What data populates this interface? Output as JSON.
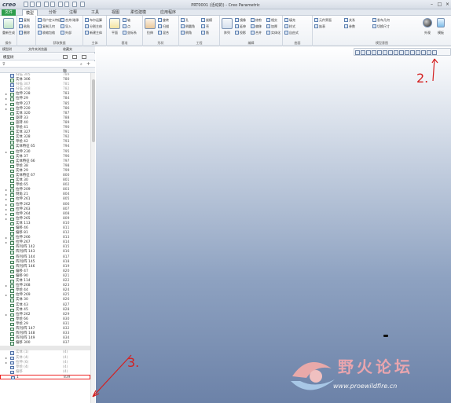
{
  "window": {
    "logo": "creo",
    "title": "PRT0001 (活动的) - Creo Parametric"
  },
  "menu": {
    "items": [
      "文件",
      "模型",
      "分析",
      "注释",
      "工具",
      "视图",
      "柔性建模",
      "应用程序"
    ],
    "active_index": 0,
    "selected_index": 1
  },
  "ribbon": {
    "groups": [
      {
        "label": "操作",
        "items": [
          "重新生成",
          "复制",
          "粘贴",
          "删除"
        ]
      },
      {
        "label": "获取数据",
        "items": [
          "用户定义特征",
          "复制几何",
          "收缩包络",
          "合并/继承",
          "导入",
          "外部"
        ]
      },
      {
        "label": "主体",
        "items": [
          "布尔运算",
          "分割主体",
          "新建主体"
        ]
      },
      {
        "label": "基准",
        "items": [
          "平面",
          "轴",
          "点",
          "坐标系",
          "草绘"
        ]
      },
      {
        "label": "形状",
        "items": [
          "拉伸",
          "旋转",
          "扫描",
          "混合",
          "扫描混合"
        ]
      },
      {
        "label": "工程",
        "items": [
          "孔",
          "倒圆角",
          "倒角",
          "拔模",
          "壳",
          "筋"
        ]
      },
      {
        "label": "编辑",
        "items": [
          "阵列",
          "镜像",
          "延伸",
          "投影",
          "修剪",
          "偏移",
          "合并",
          "相交",
          "加厚",
          "实体化",
          "移除"
        ]
      },
      {
        "label": "曲面",
        "items": [
          "填充",
          "样式",
          "自由式"
        ]
      },
      {
        "label": "模型意图",
        "items": [
          "元件界面",
          "族表",
          "关系",
          "参数",
          "发布几何",
          "切换尺寸",
          "外观",
          "模板"
        ]
      }
    ]
  },
  "sidebar": {
    "tabs": [
      "模型树",
      "文件夹浏览器",
      "收藏夹"
    ],
    "header": "模型树",
    "col_name": "",
    "col_num": "标",
    "rows": [
      {
        "name": "扫描 305",
        "num": "789",
        "type": "sup"
      },
      {
        "name": "实体 306",
        "num": "780",
        "type": "feat"
      },
      {
        "name": "扫描 307",
        "num": "781",
        "type": "sup"
      },
      {
        "name": "扫描 308",
        "num": "782",
        "type": "sup"
      },
      {
        "name": "拉伸 228",
        "num": "783",
        "type": "feat",
        "expand": true
      },
      {
        "name": "拉伸 29",
        "num": "784",
        "type": "feat",
        "expand": true
      },
      {
        "name": "拉伸 227",
        "num": "785",
        "type": "feat",
        "expand": true
      },
      {
        "name": "拉伸 220",
        "num": "786",
        "type": "feat",
        "expand": true
      },
      {
        "name": "实体 320",
        "num": "787",
        "type": "feat"
      },
      {
        "name": "旋转 33",
        "num": "788",
        "type": "feat"
      },
      {
        "name": "旋转 40",
        "num": "789",
        "type": "feat"
      },
      {
        "name": "草绘 41",
        "num": "790",
        "type": "feat"
      },
      {
        "name": "实体 327",
        "num": "791",
        "type": "feat"
      },
      {
        "name": "实体 328",
        "num": "792",
        "type": "feat"
      },
      {
        "name": "草绘 42",
        "num": "793",
        "type": "feat"
      },
      {
        "name": "实体特征 65",
        "num": "794",
        "type": "feat"
      },
      {
        "name": "拉伸 230",
        "num": "795",
        "type": "feat",
        "expand": true
      },
      {
        "name": "实体 37",
        "num": "796",
        "type": "feat"
      },
      {
        "name": "实体特征 66",
        "num": "797",
        "type": "feat"
      },
      {
        "name": "草绘 38",
        "num": "798",
        "type": "feat"
      },
      {
        "name": "实体 29",
        "num": "799",
        "type": "feat"
      },
      {
        "name": "实体特征 67",
        "num": "800",
        "type": "feat"
      },
      {
        "name": "实体 30",
        "num": "801",
        "type": "feat"
      },
      {
        "name": "草绘 65",
        "num": "802",
        "type": "feat"
      },
      {
        "name": "拉伸 209",
        "num": "803",
        "type": "feat",
        "expand": true
      },
      {
        "name": "倒角 21",
        "num": "804",
        "type": "feat",
        "expand": true
      },
      {
        "name": "拉伸 261",
        "num": "805",
        "type": "feat",
        "expand": true
      },
      {
        "name": "拉伸 262",
        "num": "806",
        "type": "feat",
        "expand": true
      },
      {
        "name": "拉伸 263",
        "num": "807",
        "type": "feat",
        "expand": true
      },
      {
        "name": "拉伸 264",
        "num": "808",
        "type": "feat",
        "expand": true
      },
      {
        "name": "拉伸 265",
        "num": "809",
        "type": "feat",
        "expand": true
      },
      {
        "name": "实体 113",
        "num": "810",
        "type": "feat"
      },
      {
        "name": "偏移 46",
        "num": "811",
        "type": "feat"
      },
      {
        "name": "偏移 81",
        "num": "812",
        "type": "feat"
      },
      {
        "name": "拉伸 266",
        "num": "813",
        "type": "feat",
        "expand": true
      },
      {
        "name": "拉伸 267",
        "num": "814",
        "type": "feat",
        "expand": true
      },
      {
        "name": "阵列/阵 142",
        "num": "815",
        "type": "feat"
      },
      {
        "name": "阵列/阵 143",
        "num": "816",
        "type": "feat"
      },
      {
        "name": "阵列/阵 144",
        "num": "817",
        "type": "feat"
      },
      {
        "name": "阵列/阵 145",
        "num": "818",
        "type": "feat"
      },
      {
        "name": "阵列/阵 146",
        "num": "819",
        "type": "feat"
      },
      {
        "name": "偏移 47",
        "num": "820",
        "type": "feat"
      },
      {
        "name": "偏移 90",
        "num": "821",
        "type": "feat"
      },
      {
        "name": "实体 114",
        "num": "822",
        "type": "feat"
      },
      {
        "name": "拉伸 268",
        "num": "823",
        "type": "feat",
        "expand": true
      },
      {
        "name": "草绘 44",
        "num": "824",
        "type": "feat"
      },
      {
        "name": "拉伸 269",
        "num": "825",
        "type": "feat",
        "expand": true
      },
      {
        "name": "实体 30",
        "num": "826",
        "type": "feat"
      },
      {
        "name": "实体 43",
        "num": "827",
        "type": "feat"
      },
      {
        "name": "实体 45",
        "num": "828",
        "type": "feat"
      },
      {
        "name": "拉伸 262",
        "num": "829",
        "type": "feat",
        "expand": true
      },
      {
        "name": "草绘 66",
        "num": "830",
        "type": "feat"
      },
      {
        "name": "草绘 29",
        "num": "831",
        "type": "feat"
      },
      {
        "name": "阵列/阵 147",
        "num": "832",
        "type": "feat"
      },
      {
        "name": "阵列/阵 148",
        "num": "833",
        "type": "feat"
      },
      {
        "name": "阵列/阵 149",
        "num": "834",
        "type": "feat"
      },
      {
        "name": "偏移 300",
        "num": "837",
        "type": "feat"
      },
      {
        "name": "",
        "num": "",
        "type": "dim"
      },
      {
        "name": "实体 (1)",
        "num": "(4)",
        "type": "sup"
      },
      {
        "name": "实体 (4)",
        "num": "(4)",
        "type": "sup",
        "expand": true
      },
      {
        "name": "拉伸 (6)",
        "num": "(4)",
        "type": "sup",
        "expand": true
      },
      {
        "name": "草绘 (4)",
        "num": "(4)",
        "type": "sup"
      },
      {
        "name": "偏移",
        "num": "(4)",
        "type": "sup"
      },
      {
        "name": "1",
        "num": "839",
        "type": "hl"
      }
    ]
  },
  "annotations": {
    "two": "2.",
    "three": "3."
  },
  "watermark": {
    "cn": "野火论坛",
    "url": "www.proewildfire.cn"
  }
}
